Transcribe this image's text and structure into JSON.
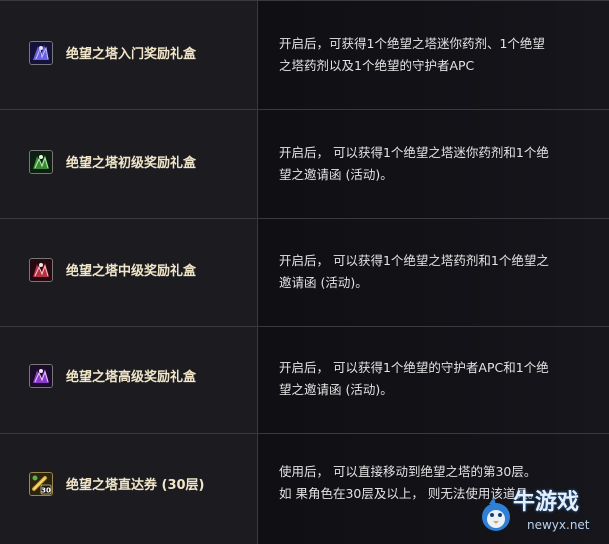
{
  "rows": [
    {
      "icon": "purple-gift-box-icon",
      "icon_color": "#5a4fd6",
      "name": "绝望之塔入门奖励礼盒",
      "desc_lines": [
        "开启后，可获得1个绝望之塔迷你药剂、1个绝望",
        "之塔药剂以及1个绝望的守护者APC"
      ]
    },
    {
      "icon": "green-gift-box-icon",
      "icon_color": "#3d8a3a",
      "name": "绝望之塔初级奖励礼盒",
      "desc_lines": [
        "开启后， 可以获得1个绝望之塔迷你药剂和1个绝",
        "望之邀请函 (活动)。"
      ]
    },
    {
      "icon": "red-gift-box-icon",
      "icon_color": "#b53145",
      "name": "绝望之塔中级奖励礼盒",
      "desc_lines": [
        "开启后， 可以获得1个绝望之塔药剂和1个绝望之",
        "邀请函 (活动)。"
      ]
    },
    {
      "icon": "violet-gift-box-icon",
      "icon_color": "#8a3cc8",
      "name": "绝望之塔高级奖励礼盒",
      "desc_lines": [
        "开启后， 可以获得1个绝望的守护者APC和1个绝",
        "望之邀请函 (活动)。"
      ]
    },
    {
      "icon": "floor-ticket-30-icon",
      "icon_color": "#c9a23a",
      "name": "绝望之塔直达券 (30层)",
      "desc_lines": [
        "使用后， 可以直接移动到绝望之塔的第30层。",
        "如 果角色在30层及以上， 则无法使用该道具。"
      ]
    }
  ],
  "watermark": {
    "title": "牛游戏",
    "subtitle": "newyx.net",
    "logo": "bird-logo-icon"
  },
  "ticket_icon_text": "30"
}
